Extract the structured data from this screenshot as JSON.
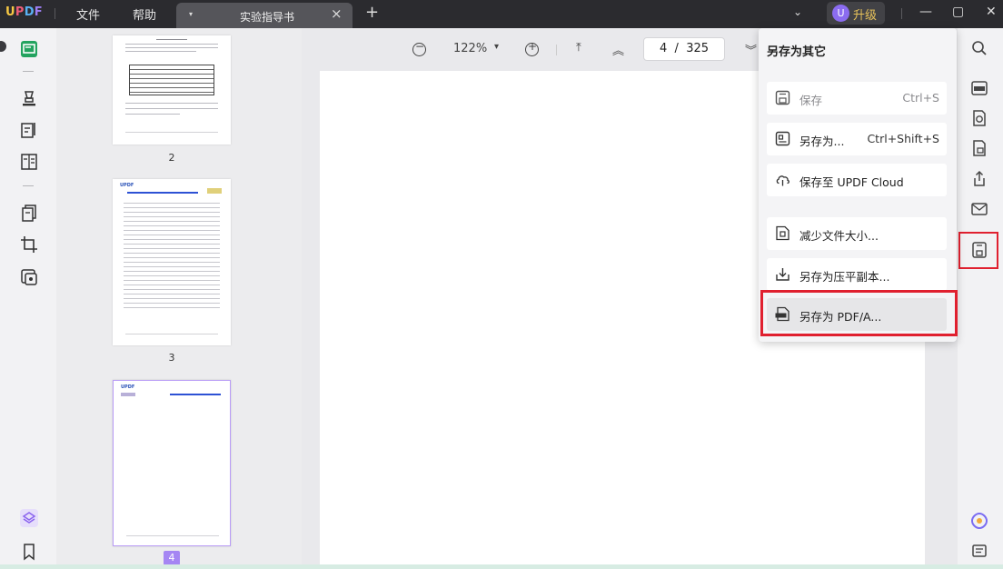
{
  "titlebar": {
    "logo": {
      "u": "U",
      "p": "P",
      "d": "D",
      "f": "F"
    },
    "menu": [
      "文件",
      "帮助"
    ],
    "tab": {
      "title": "实验指导书",
      "arrow": "▾",
      "close": "×"
    },
    "new_tab": "+",
    "dropdown_chevron": "⌄",
    "user_initial": "U",
    "upgrade_label": "升级",
    "window_controls": {
      "minimize": "—",
      "maximize": "▢",
      "close": "✕"
    }
  },
  "thumbnails": {
    "pages": [
      {
        "number": "2"
      },
      {
        "number": "3"
      },
      {
        "number": "4",
        "selected": true
      }
    ]
  },
  "viewer_toolbar": {
    "zoom_out": "−",
    "zoom_level": "122%",
    "zoom_dropdown": "▾",
    "zoom_in": "+",
    "first_page": "⤒",
    "prev_page": "︽",
    "current_page": "4",
    "separator": "/",
    "total_pages": "325",
    "next_page": "︾"
  },
  "save_menu": {
    "title": "另存为其它",
    "items": [
      {
        "label": "保存",
        "shortcut": "Ctrl+S",
        "icon": "save-icon",
        "disabled": true
      },
      {
        "label": "另存为...",
        "shortcut": "Ctrl+Shift+S",
        "icon": "save-as-icon"
      },
      {
        "label": "保存至 UPDF Cloud",
        "shortcut": "",
        "icon": "cloud-icon"
      },
      {
        "label": "减少文件大小...",
        "shortcut": "",
        "icon": "compress-icon"
      },
      {
        "label": "另存为压平副本...",
        "shortcut": "",
        "icon": "flatten-icon"
      },
      {
        "label": "另存为 PDF/A...",
        "shortcut": "",
        "icon": "pdfa-icon",
        "active": true
      }
    ]
  },
  "thumb_text": {
    "logo": "UPDF"
  },
  "colors": {
    "accent_purple": "#a586f3",
    "highlight_red": "#e0202f",
    "active_green": "#23a35f"
  }
}
